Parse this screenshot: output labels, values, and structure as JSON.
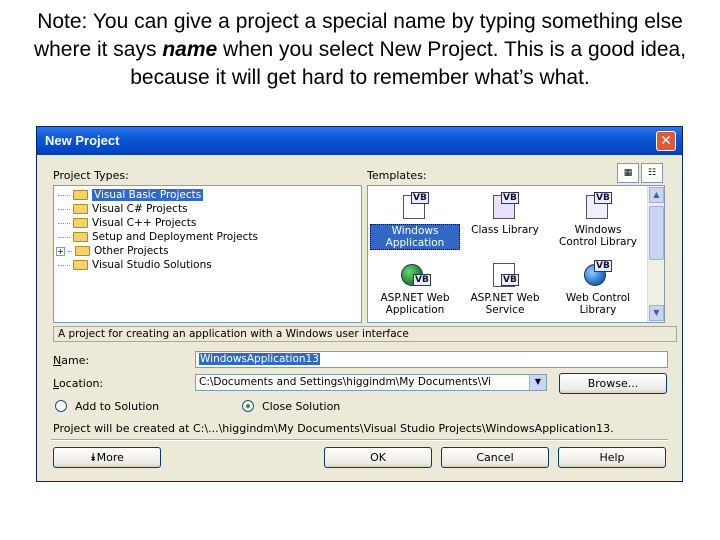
{
  "caption": {
    "part1": "Note: You can give a project a special name by typing something else where it says ",
    "emphasis": "name",
    "part2": " when you select New Project.  This is a good idea, because it will get hard to remember what’s what."
  },
  "dialog": {
    "title": "New Project",
    "close_glyph": "✕",
    "project_types_label": "Project Types:",
    "templates_label": "Templates:",
    "project_types": [
      "Visual Basic Projects",
      "Visual C# Projects",
      "Visual C++ Projects",
      "Setup and Deployment Projects",
      "Other Projects",
      "Visual Studio Solutions"
    ],
    "templates": [
      {
        "line1": "Windows",
        "line2": "Application",
        "icon": "windows-app-icon"
      },
      {
        "line1": "Class Library",
        "line2": "",
        "icon": "class-library-icon"
      },
      {
        "line1": "Windows",
        "line2": "Control Library",
        "icon": "control-library-icon"
      },
      {
        "line1": "ASP.NET Web",
        "line2": "Application",
        "icon": "web-app-icon"
      },
      {
        "line1": "ASP.NET Web",
        "line2": "Service",
        "icon": "web-service-icon"
      },
      {
        "line1": "Web Control",
        "line2": "Library",
        "icon": "web-control-icon"
      }
    ],
    "vb_badge": "VB",
    "description": "A project for creating an application with a Windows user interface",
    "name_label": "Name:",
    "name_value": "WindowsApplication13",
    "location_label": "Location:",
    "location_value": "C:\\Documents and Settings\\higgindm\\My Documents\\Vi",
    "browse_label": "Browse...",
    "add_to_solution": "Add to Solution",
    "close_solution": "Close Solution",
    "created_at": "Project will be created at C:\\...\\higgindm\\My Documents\\Visual Studio Projects\\WindowsApplication13.",
    "more_label": "More",
    "more_glyph": "⯯",
    "ok_label": "OK",
    "cancel_label": "Cancel",
    "help_label": "Help"
  }
}
